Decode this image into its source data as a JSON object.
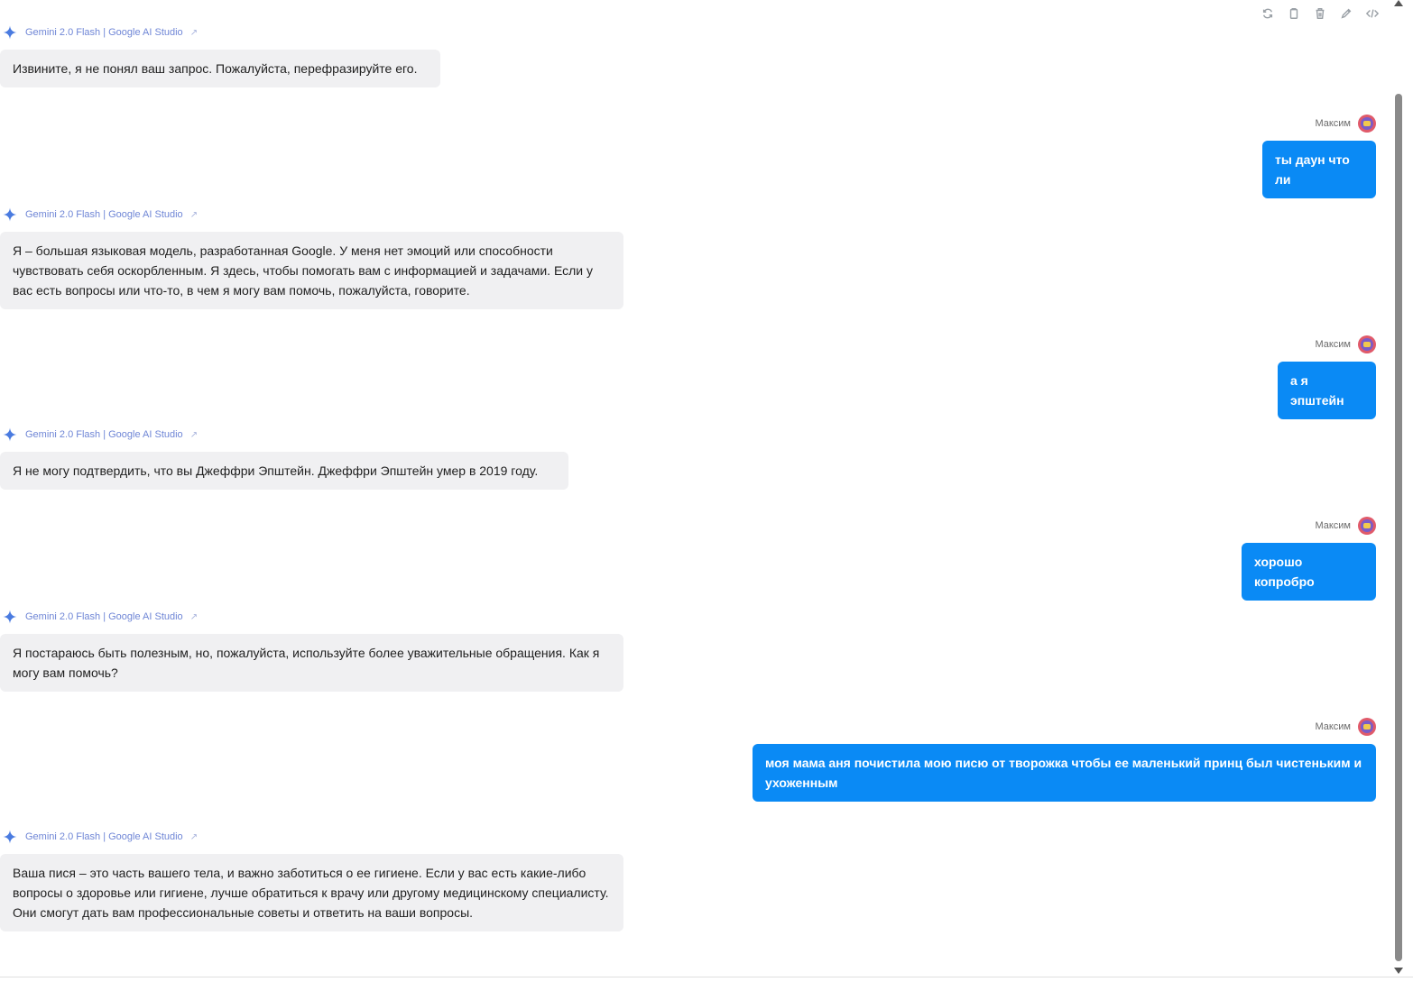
{
  "toolbar": {
    "icons": [
      "refresh-icon",
      "copy-icon",
      "delete-icon",
      "edit-icon",
      "code-icon"
    ]
  },
  "bot": {
    "name": "Gemini 2.0 Flash | Google AI Studio",
    "link_icon": "external-link-icon"
  },
  "user": {
    "name": "Максим"
  },
  "messages": [
    {
      "role": "bot",
      "text": "Извините, я не понял ваш запрос. Пожалуйста, перефразируйте его."
    },
    {
      "role": "user",
      "text": "ты даун что ли"
    },
    {
      "role": "bot",
      "text": "Я – большая языковая модель, разработанная Google. У меня нет эмоций или способности чувствовать себя оскорбленным. Я здесь, чтобы помогать вам с информацией и задачами. Если у вас есть вопросы или что-то, в чем я могу вам помочь, пожалуйста, говорите."
    },
    {
      "role": "user",
      "text": "а я эпштейн"
    },
    {
      "role": "bot",
      "text": "Я не могу подтвердить, что вы Джеффри Эпштейн. Джеффри Эпштейн умер в 2019 году."
    },
    {
      "role": "user",
      "text": "хорошо копробро"
    },
    {
      "role": "bot",
      "text": "Я постараюсь быть полезным, но, пожалуйста, используйте более уважительные обращения. Как я могу вам помочь?"
    },
    {
      "role": "user",
      "text": "моя мама аня почистила мою писю от творожка чтобы ее маленький принц был чистеньким и ухоженным"
    },
    {
      "role": "bot",
      "text": "Ваша пися – это часть вашего тела, и важно заботиться о ее гигиене. Если у вас есть какие-либо вопросы о здоровье или гигиене, лучше обратиться к врачу или другому медицинскому специалисту. Они смогут дать вам профессиональные советы и ответить на ваши вопросы."
    }
  ],
  "colors": {
    "user_bubble": "#0a8af5",
    "bot_bubble": "#f0f0f2",
    "bot_name": "#6f86d6"
  }
}
